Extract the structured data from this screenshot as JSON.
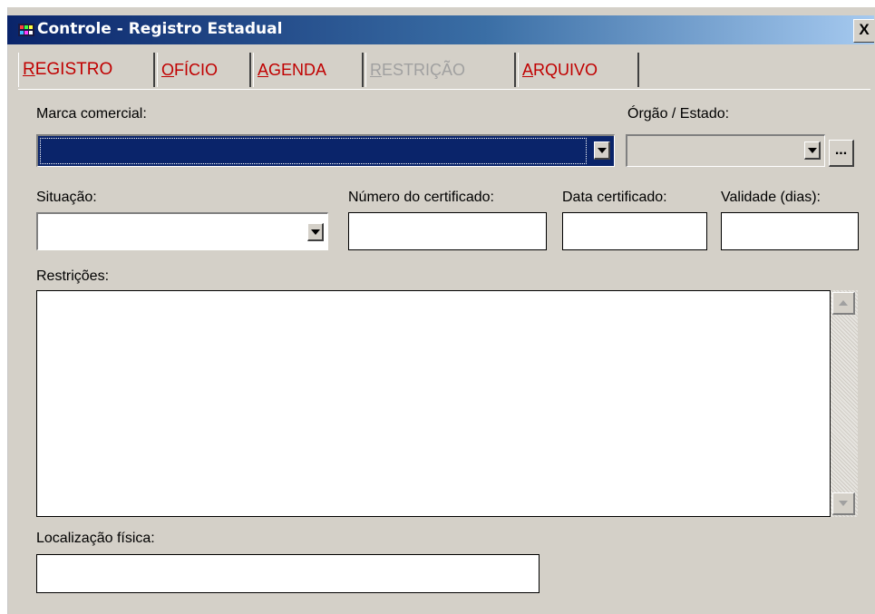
{
  "window": {
    "title": "Controle - Registro Estadual",
    "close_label": "X"
  },
  "tabs": [
    {
      "label": "REGISTRO",
      "mnemonic": "R",
      "rest": "EGISTRO",
      "state": "active"
    },
    {
      "label": "OFÍCIO",
      "mnemonic": "O",
      "rest": "FÍCIO",
      "state": "normal"
    },
    {
      "label": "AGENDA",
      "mnemonic": "A",
      "rest": "GENDA",
      "state": "normal"
    },
    {
      "label": "RESTRIÇÃO",
      "mnemonic": "R",
      "rest": "ESTRIÇÃO",
      "state": "disabled"
    },
    {
      "label": "ARQUIVO",
      "mnemonic": "A",
      "rest": "RQUIVO",
      "state": "normal"
    }
  ],
  "form": {
    "marca_label": "Marca comercial:",
    "marca_value": "",
    "orgao_label": "Órgão / Estado:",
    "orgao_value": "",
    "orgao_button": "...",
    "situacao_label": "Situação:",
    "situacao_value": "",
    "numero_label": "Número do certificado:",
    "numero_value": "",
    "data_label": "Data certificado:",
    "data_value": "",
    "validade_label": "Validade (dias):",
    "validade_value": "",
    "restricoes_label": "Restrições:",
    "restricoes_value": "",
    "localizacao_label": "Localização física:",
    "localizacao_value": ""
  },
  "colors": {
    "title_start": "#0a246a",
    "title_end": "#a6caf0",
    "tab_text": "#c00000",
    "selected": "#0a246a",
    "face": "#d4d0c8"
  }
}
